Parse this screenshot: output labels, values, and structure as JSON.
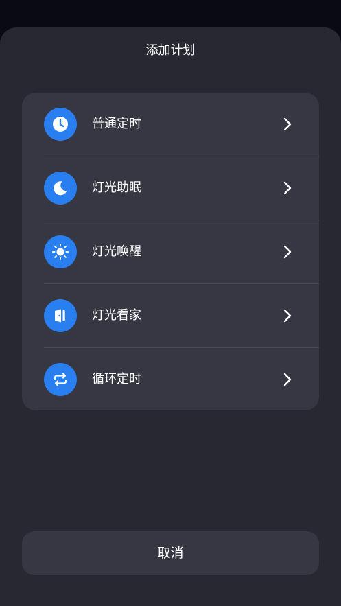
{
  "sheet": {
    "title": "添加计划"
  },
  "menu": {
    "items": [
      {
        "label": "普通定时",
        "icon": "clock-icon"
      },
      {
        "label": "灯光助眠",
        "icon": "moon-icon"
      },
      {
        "label": "灯光唤醒",
        "icon": "sun-icon"
      },
      {
        "label": "灯光看家",
        "icon": "door-icon"
      },
      {
        "label": "循环定时",
        "icon": "repeat-icon"
      }
    ]
  },
  "cancel_label": "取消",
  "colors": {
    "icon_background": "#2a7ff0",
    "sheet_background": "#282833",
    "card_background": "#373743"
  }
}
